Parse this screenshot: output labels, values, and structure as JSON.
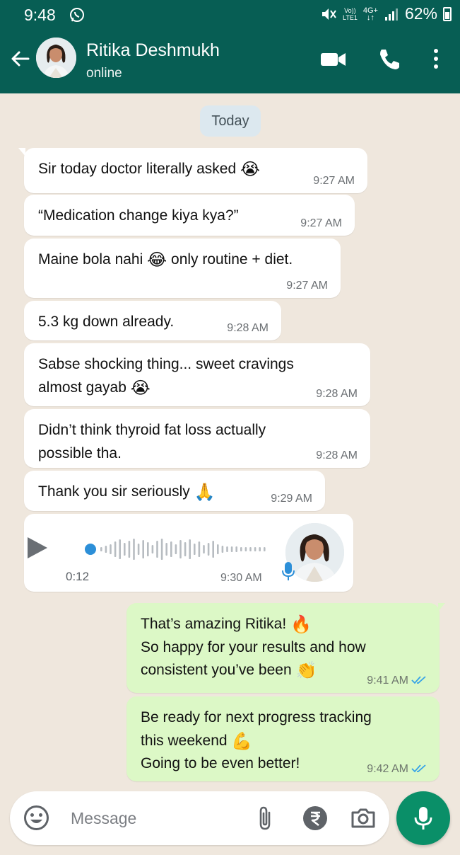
{
  "status_bar": {
    "time": "9:48",
    "network_line1": "Vo))",
    "network_line2": "LTE1",
    "network_type": "4G+",
    "battery": "62%"
  },
  "header": {
    "contact_name": "Ritika Deshmukh",
    "contact_status": "online",
    "icons": [
      "back-arrow-icon",
      "video-call-icon",
      "phone-icon",
      "more-vert-icon"
    ]
  },
  "day_pill": "Today",
  "messages": [
    {
      "direction": "in",
      "text": "Sir today doctor literally asked",
      "emoji": "😭",
      "time": "9:27 AM"
    },
    {
      "direction": "in",
      "text": "“Medication change kiya kya?”",
      "time": "9:27 AM"
    },
    {
      "direction": "in",
      "text_before": "Maine bola nahi",
      "emoji": "😂",
      "text_after": "only routine + diet.",
      "time": "9:27 AM"
    },
    {
      "direction": "in",
      "text": "5.3 kg down already.",
      "time": "9:28 AM"
    },
    {
      "direction": "in",
      "line1": "Sabse shocking thing... sweet cravings",
      "line2": "almost gayab",
      "emoji": "😭",
      "time": "9:28 AM"
    },
    {
      "direction": "in",
      "line1": "Didn’t think thyroid fat loss actually",
      "line2": "possible tha.",
      "time": "9:28 AM"
    },
    {
      "direction": "in",
      "text": "Thank you sir seriously",
      "emoji": "🙏",
      "time": "9:29 AM"
    },
    {
      "direction": "out",
      "line1": "That’s amazing Ritika!",
      "emoji1": "🔥",
      "line2": "So happy for your results and how",
      "line3": "consistent you’ve been",
      "emoji3": "👏",
      "time": "9:41 AM"
    },
    {
      "direction": "out",
      "line1": "Be ready for next progress tracking",
      "line2": "this weekend",
      "emoji2": "💪",
      "line3": "Going to be even better!",
      "time": "9:42 AM"
    }
  ],
  "voice_note": {
    "duration": "0:12",
    "time": "9:30 AM",
    "progress": 0.0
  },
  "composer": {
    "placeholder": "Message",
    "icons": [
      "emoji-icon",
      "attach-icon",
      "rupee-icon",
      "camera-icon",
      "mic-icon"
    ]
  },
  "colors": {
    "header": "#075e54",
    "chat_bg": "#efe7dd",
    "incoming": "#ffffff",
    "outgoing": "#dcf8c6",
    "accent": "#0a8f68",
    "read_tick": "#34a2e8"
  }
}
